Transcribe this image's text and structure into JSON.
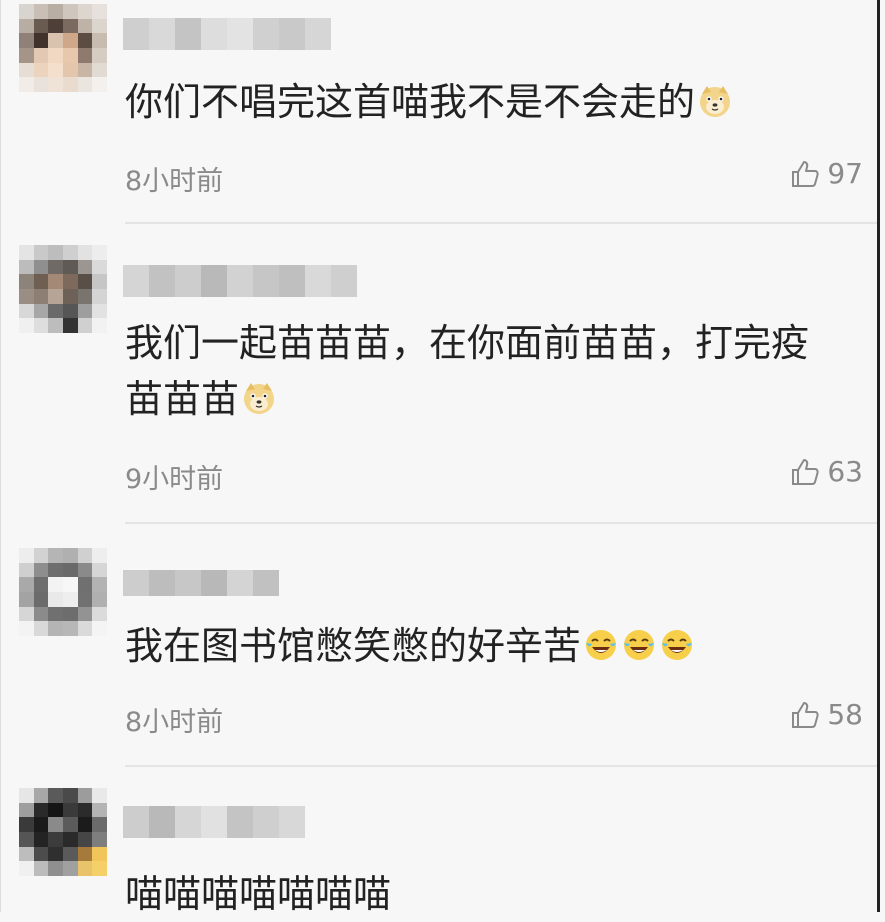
{
  "comments": [
    {
      "text": "你们不唱完这首喵我不是不会走的",
      "emojis": [
        "doge-emoji"
      ],
      "time": "8小时前",
      "likes": "97"
    },
    {
      "text_line1": "我们一起苗苗苗，在你面前苗苗，打完疫",
      "text_line2": "苗苗苗",
      "emojis": [
        "doge-emoji"
      ],
      "time": "9小时前",
      "likes": "63"
    },
    {
      "text": "我在图书馆憋笑憋的好辛苦",
      "emojis": [
        "laugh-cry-emoji",
        "laugh-cry-emoji",
        "laugh-cry-emoji"
      ],
      "time": "8小时前",
      "likes": "58"
    },
    {
      "text": "喵喵喵喵喵喵喵"
    }
  ],
  "colors": {
    "background": "#f7f7f7",
    "text": "#222222",
    "meta": "#8a8a8a",
    "divider": "#e4e4e4"
  },
  "icons": [
    "thumbs-up-icon",
    "doge-emoji",
    "laugh-cry-emoji"
  ]
}
